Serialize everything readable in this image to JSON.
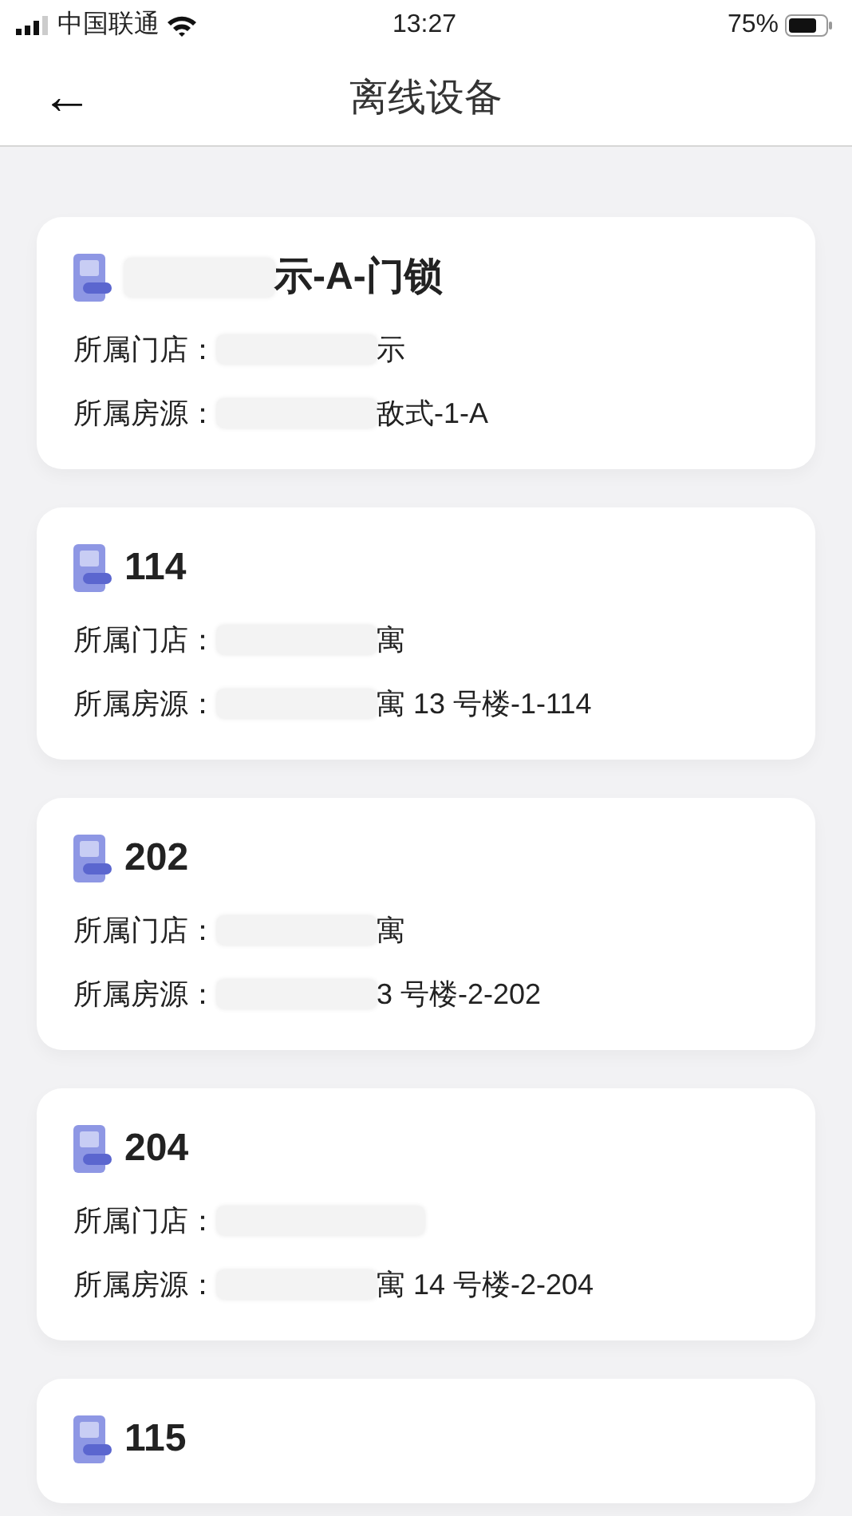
{
  "status_bar": {
    "carrier": "中国联通",
    "time": "13:27",
    "battery": "75%"
  },
  "header": {
    "back": "←",
    "title": "离线设备"
  },
  "devices": [
    {
      "name": "示-A-门锁",
      "name_redacted": true,
      "fields": [
        {
          "label": "所属门店：",
          "value": "示",
          "redacted": true
        },
        {
          "label": "所属房源：",
          "value": "敌式-1-A",
          "redacted": true
        }
      ]
    },
    {
      "name": "114",
      "fields": [
        {
          "label": "所属门店：",
          "value": "寓",
          "redacted": true
        },
        {
          "label": "所属房源：",
          "value": "寓 13 号楼-1-114",
          "redacted": true
        }
      ]
    },
    {
      "name": "202",
      "fields": [
        {
          "label": "所属门店：",
          "value": "寓",
          "redacted": true
        },
        {
          "label": "所属房源：",
          "value": "3 号楼-2-202",
          "redacted": true
        }
      ]
    },
    {
      "name": "204",
      "fields": [
        {
          "label": "所属门店：",
          "redacted": true
        },
        {
          "label": "所属房源：",
          "value": "寓 14 号楼-2-204",
          "redacted": true
        }
      ]
    },
    {
      "name": "115"
    }
  ]
}
